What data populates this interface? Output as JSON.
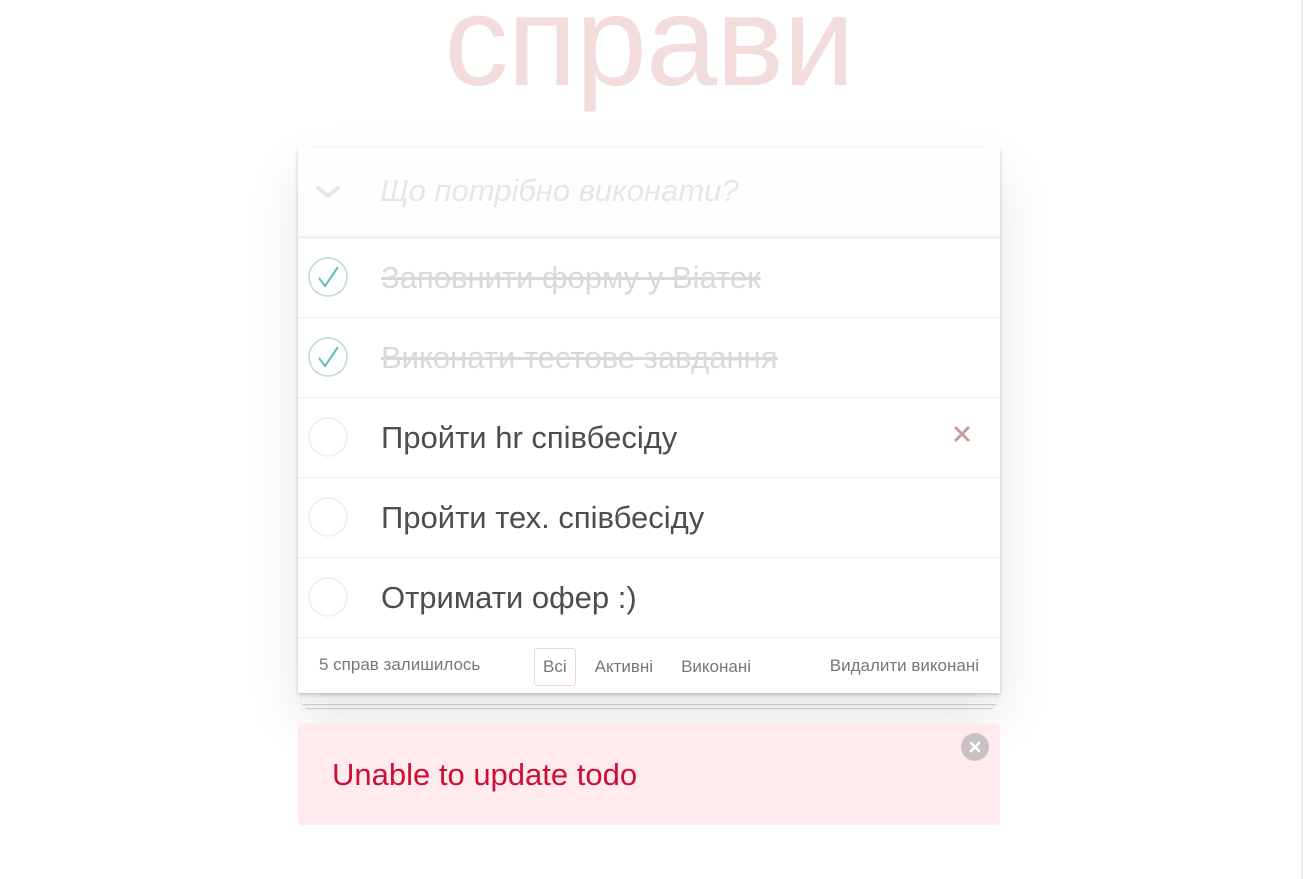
{
  "app": {
    "title": "справи"
  },
  "new_todo": {
    "placeholder": "Що потрібно виконати?",
    "value": ""
  },
  "todos": [
    {
      "label": "Заповнити форму у Віатек",
      "completed": true
    },
    {
      "label": "Виконати тестове завдання",
      "completed": true
    },
    {
      "label": "Пройти hr співбесіду",
      "completed": false
    },
    {
      "label": "Пройти тех. співбесіду",
      "completed": false
    },
    {
      "label": "Отримати офер :)",
      "completed": false
    }
  ],
  "footer": {
    "count_text": "5 справ залишилось",
    "filters": [
      {
        "label": "Всі",
        "selected": true
      },
      {
        "label": "Активні",
        "selected": false
      },
      {
        "label": "Виконані",
        "selected": false
      }
    ],
    "clear_completed_label": "Видалити виконані"
  },
  "notification": {
    "message": "Unable to update todo",
    "type": "error"
  },
  "colors": {
    "title": "#f2dcdc",
    "check_completed": "#5dc2af",
    "destroy": "#cc9a9a",
    "error_bg": "#ffebee",
    "error_text": "#cc0f35"
  },
  "icons": {
    "toggle_all": "chevron-down-icon",
    "checked": "checkmark-icon",
    "unchecked": "empty-circle-icon",
    "destroy": "close-icon",
    "error_close": "close-circle-icon"
  }
}
